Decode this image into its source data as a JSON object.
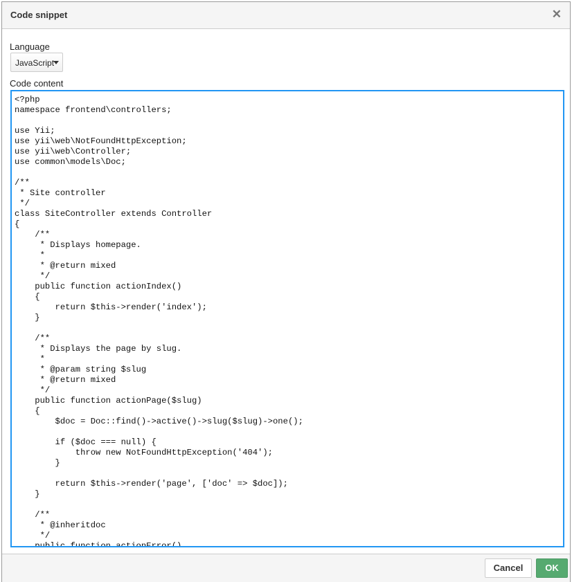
{
  "dialog": {
    "title": "Code snippet",
    "close_icon": "x",
    "language_label": "Language",
    "language_value": "JavaScript",
    "code_label": "Code content",
    "code": "<?php\nnamespace frontend\\controllers;\n\nuse Yii;\nuse yii\\web\\NotFoundHttpException;\nuse yii\\web\\Controller;\nuse common\\models\\Doc;\n\n/**\n * Site controller\n */\nclass SiteController extends Controller\n{\n    /**\n     * Displays homepage.\n     *\n     * @return mixed\n     */\n    public function actionIndex()\n    {\n        return $this->render('index');\n    }\n\n    /**\n     * Displays the page by slug.\n     *\n     * @param string $slug\n     * @return mixed\n     */\n    public function actionPage($slug)\n    {\n        $doc = Doc::find()->active()->slug($slug)->one();\n\n        if ($doc === null) {\n            throw new NotFoundHttpException('404');\n        }\n\n        return $this->render('page', ['doc' => $doc]);\n    }\n\n    /**\n     * @inheritdoc\n     */\n    public function actionError()",
    "cancel_label": "Cancel",
    "ok_label": "OK"
  }
}
